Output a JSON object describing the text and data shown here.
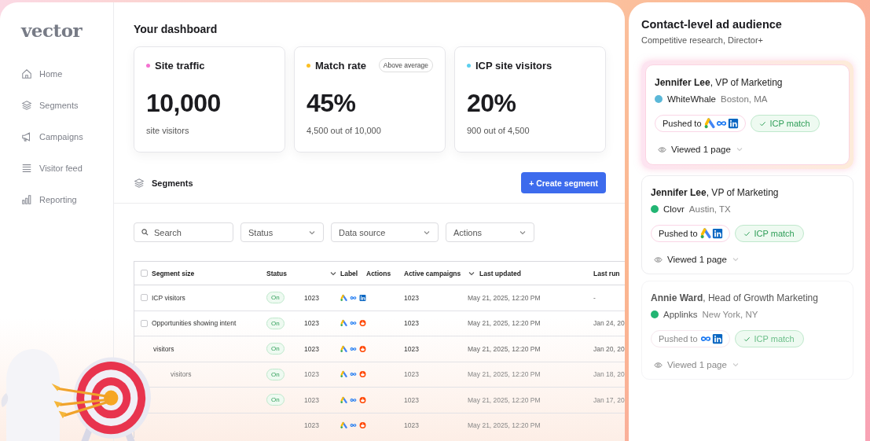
{
  "sidebar": {
    "logo": "vector",
    "items": [
      {
        "label": "Home"
      },
      {
        "label": "Segments"
      },
      {
        "label": "Campaigns"
      },
      {
        "label": "Visitor feed"
      },
      {
        "label": "Reporting"
      }
    ]
  },
  "dashboard": {
    "title": "Your dashboard",
    "stats": [
      {
        "title": "Site traffic",
        "color": "#f472d0",
        "value": "10,000",
        "caption": "site visitors"
      },
      {
        "title": "Match rate",
        "color": "#fbbf24",
        "badge": "Above average",
        "value": "45%",
        "caption": "4,500 out of 10,000"
      },
      {
        "title": "ICP site visitors",
        "color": "#5ccfee",
        "value": "20%",
        "caption": "900 out of 4,500"
      }
    ]
  },
  "segments": {
    "title": "Segments",
    "create_button": "+ Create segment",
    "search": {
      "placeholder": "Search"
    },
    "filters": [
      "Status",
      "Data source",
      "Actions"
    ],
    "table": {
      "header_checked": false,
      "columns": [
        "Segment size",
        "Status",
        "Label",
        "Actions",
        "Active campaigns",
        "Last updated",
        "Last run"
      ],
      "rows": [
        {
          "name": "ICP visitors",
          "checked": false,
          "status": "On",
          "count": "1023",
          "channels": [
            {
              "kind": "triangle"
            },
            {
              "kind": "infinity"
            },
            {
              "kind": "square"
            }
          ],
          "campaigns": "1023",
          "updated": "May 21, 2025, 12:20 PM",
          "last_run": "-"
        },
        {
          "name": "Opportunities showing intent",
          "checked": false,
          "status": "On",
          "count": "1023",
          "channels": [
            {
              "kind": "triangle"
            },
            {
              "kind": "infinity"
            },
            {
              "kind": "round"
            }
          ],
          "campaigns": "1023",
          "updated": "May 21, 2025, 12:20 PM",
          "last_run": "Jan 24, 20"
        },
        {
          "name": "visitors",
          "status": "On",
          "count": "1023",
          "channels": [
            {
              "kind": "triangle"
            },
            {
              "kind": "infinity"
            },
            {
              "kind": "round"
            }
          ],
          "campaigns": "1023",
          "updated": "May 21, 2025, 12:20 PM",
          "last_run": "Jan 20, 20"
        },
        {
          "name": "visitors",
          "status": "On",
          "count": "1023",
          "channels": [
            {
              "kind": "triangle"
            },
            {
              "kind": "infinity"
            },
            {
              "kind": "round"
            }
          ],
          "campaigns": "1023",
          "updated": "May 21, 2025, 12:20 PM",
          "last_run": "Jan 18, 20"
        },
        {
          "status": "On",
          "count": "1023",
          "channels": [
            {
              "kind": "triangle"
            },
            {
              "kind": "infinity"
            },
            {
              "kind": "round"
            }
          ],
          "campaigns": "1023",
          "updated": "May 21, 2025, 12:20 PM",
          "last_run": "Jan 17, 20"
        },
        {
          "count": "1023",
          "channels": [
            {
              "kind": "triangle"
            },
            {
              "kind": "infinity"
            },
            {
              "kind": "round"
            }
          ],
          "campaigns": "1023",
          "updated": "May 21, 2025, 12:20 PM"
        }
      ]
    }
  },
  "audience": {
    "title": "Contact-level ad audience",
    "subtitle": "Competitive research, Director+",
    "contacts": [
      {
        "headline": "**Jennifer Lee**, VP of Marketing",
        "selected": true,
        "company": "WhiteWhale",
        "color": "#5bb8d8",
        "location": "Boston, MA",
        "pushed": "Pushed to",
        "channels": [
          {
            "kind": "triangle"
          },
          {
            "kind": "infinity"
          },
          {
            "kind": "square"
          }
        ],
        "badge": "ICP match",
        "viewed": "Viewed 1 page"
      },
      {
        "headline": "**Jennifer Lee**, VP of Marketing",
        "selected": false,
        "company": "Clovr",
        "color": "#22b573",
        "location": "Austin, TX",
        "pushed": "Pushed to",
        "channels": [
          {
            "kind": "triangle"
          },
          {
            "kind": "square"
          }
        ],
        "badge": "ICP match",
        "viewed": "Viewed 1 page"
      },
      {
        "headline": "**Annie Ward**, Head of Growth Marketing",
        "selected": false,
        "company": "Applinks",
        "color": "#22b573",
        "location": "New York, NY",
        "pushed": "Pushed to",
        "channels": [
          {
            "kind": "infinity"
          },
          {
            "kind": "square"
          }
        ],
        "badge": "ICP match",
        "viewed": "Viewed 1 page"
      }
    ]
  }
}
